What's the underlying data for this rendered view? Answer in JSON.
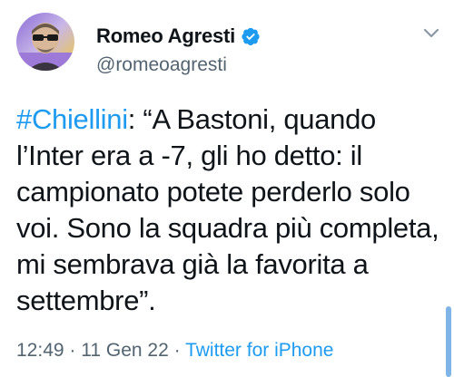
{
  "author": {
    "display_name": "Romeo Agresti",
    "handle": "@romeoagresti",
    "verified": true
  },
  "tweet": {
    "hashtag": "#Chiellini",
    "body": ": “A Bastoni, quando l’Inter era a -7, gli ho detto: il campionato potete perderlo solo voi. Sono la squadra più completa, mi sembrava già la favorita a settembre”."
  },
  "meta": {
    "time": "12:49",
    "separator": " · ",
    "date": "11 Gen 22",
    "source": "Twitter for iPhone"
  },
  "icons": {
    "verified": "verified-badge-icon",
    "menu": "chevron-down-icon"
  },
  "colors": {
    "link": "#1d9bf0",
    "secondary_text": "#536471",
    "primary_text": "#0f1419"
  }
}
